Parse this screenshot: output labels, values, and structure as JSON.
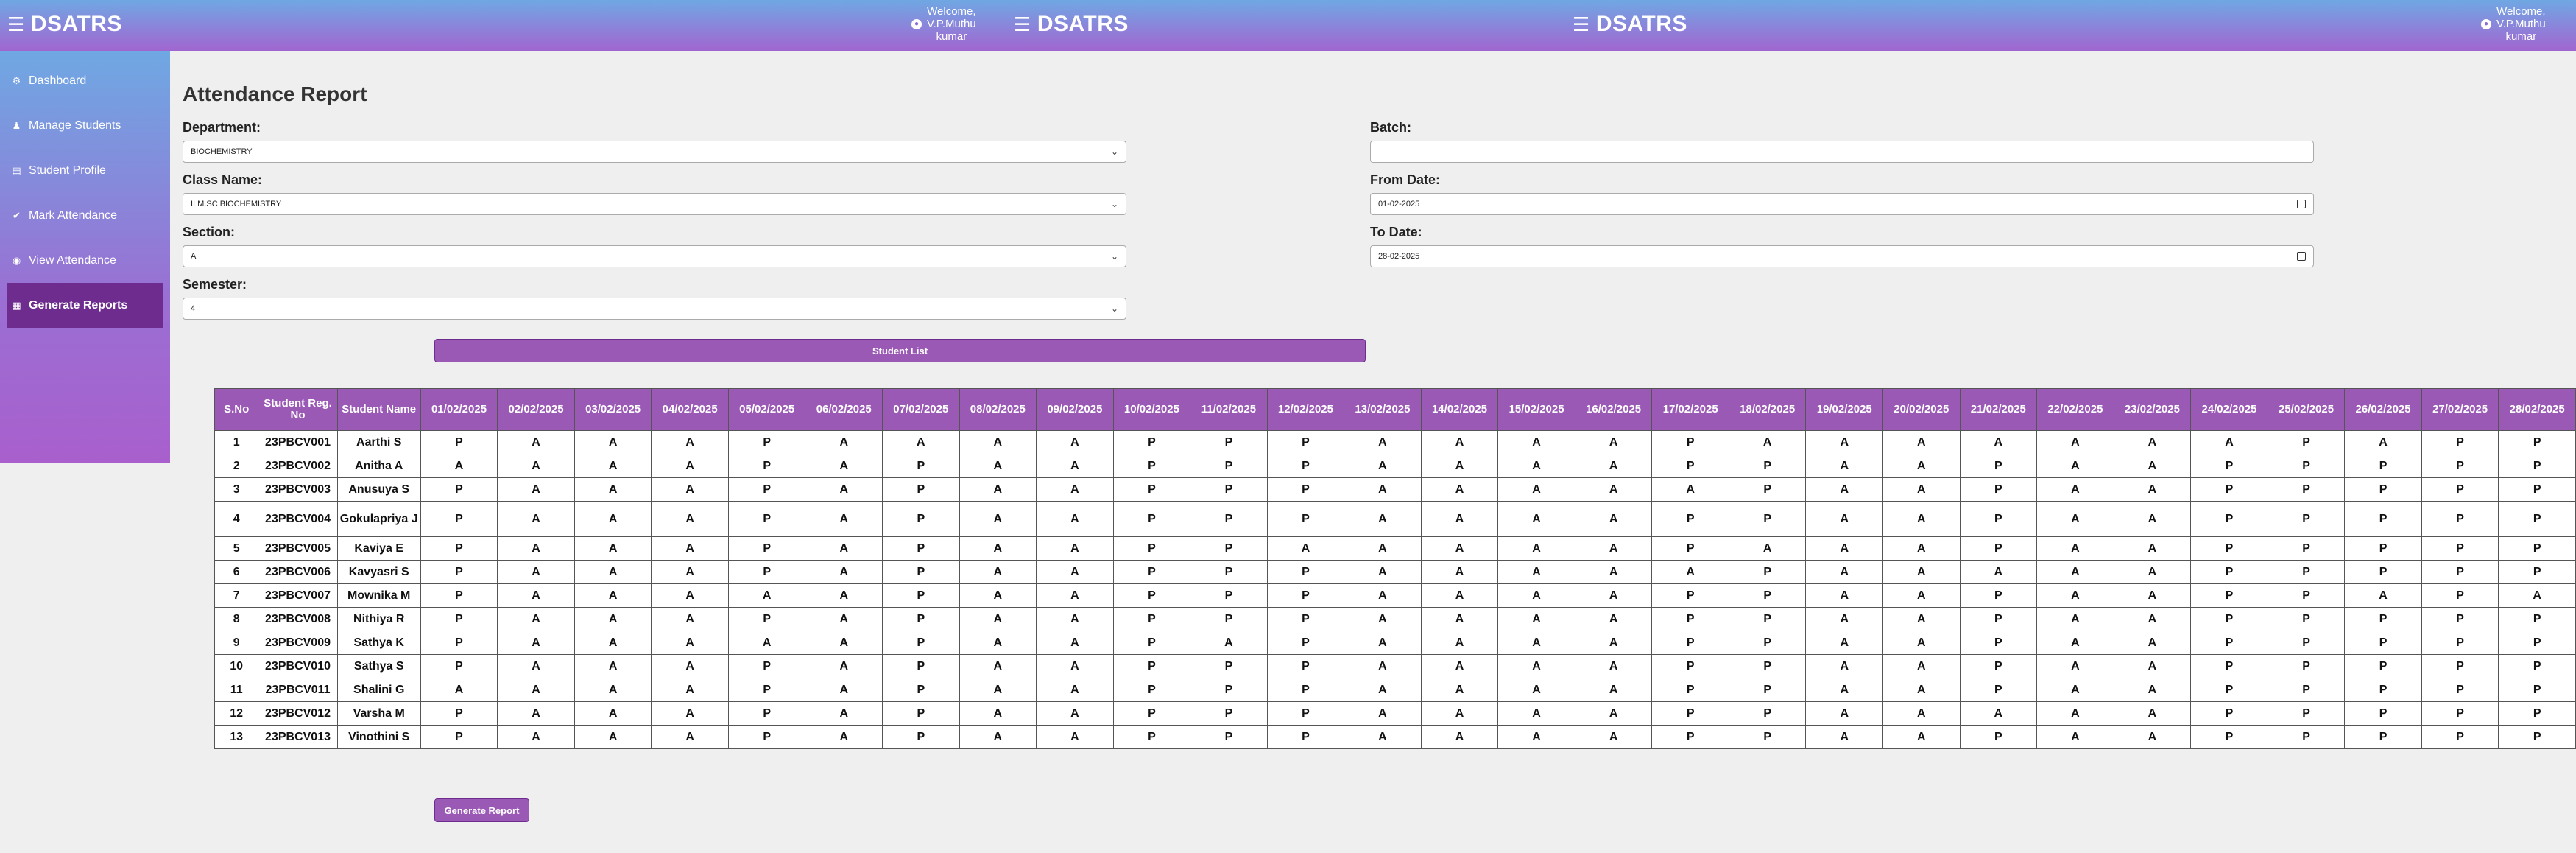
{
  "header": {
    "brand": "DSATRS",
    "welcome_line1": "Welcome,",
    "welcome_line2": "V.P.Muthu",
    "welcome_line3": "kumar",
    "welcome_line2_alt": "V.P.Muthu",
    "welcome_line3_alt": "kumar"
  },
  "sidebar": {
    "items": [
      {
        "label": "Dashboard",
        "icon": "dashboard-icon"
      },
      {
        "label": "Manage Students",
        "icon": "user-icon"
      },
      {
        "label": "Student Profile",
        "icon": "id-card-icon"
      },
      {
        "label": "Mark Attendance",
        "icon": "check-circle-icon"
      },
      {
        "label": "View Attendance",
        "icon": "eye-icon"
      },
      {
        "label": "Generate Reports",
        "icon": "file-icon"
      }
    ]
  },
  "page": {
    "title": "Attendance Report",
    "department_label": "Department:",
    "department_value": "BIOCHEMISTRY",
    "class_label": "Class Name:",
    "class_value": "II M.SC BIOCHEMISTRY",
    "section_label": "Section:",
    "section_value": "A",
    "semester_label": "Semester:",
    "semester_value": "4",
    "batch_label": "Batch:",
    "batch_value": "",
    "from_label": "From Date:",
    "from_value": "01-02-2025",
    "to_label": "To Date:",
    "to_value": "28-02-2025",
    "student_list_button": "Student List",
    "generate_button": "Generate Report"
  },
  "table": {
    "headers": [
      "S.No",
      "Student Reg. No",
      "Student Name",
      "01/02/2025",
      "02/02/2025",
      "03/02/2025",
      "04/02/2025",
      "05/02/2025",
      "06/02/2025",
      "07/02/2025",
      "08/02/2025",
      "09/02/2025",
      "10/02/2025",
      "11/02/2025",
      "12/02/2025",
      "13/02/2025",
      "14/02/2025",
      "15/02/2025",
      "16/02/2025",
      "17/02/2025",
      "18/02/2025",
      "19/02/2025",
      "20/02/2025",
      "21/02/2025",
      "22/02/2025",
      "23/02/2025",
      "24/02/2025",
      "25/02/2025",
      "26/02/2025",
      "27/02/2025",
      "28/02/2025"
    ],
    "rows": [
      [
        "1",
        "23PBCV001",
        "Aarthi S",
        "P",
        "A",
        "A",
        "A",
        "P",
        "A",
        "A",
        "A",
        "A",
        "P",
        "P",
        "P",
        "A",
        "A",
        "A",
        "A",
        "P",
        "A",
        "A",
        "A",
        "A",
        "A",
        "A",
        "A",
        "P",
        "A",
        "P",
        "P"
      ],
      [
        "2",
        "23PBCV002",
        "Anitha A",
        "A",
        "A",
        "A",
        "A",
        "P",
        "A",
        "P",
        "A",
        "A",
        "P",
        "P",
        "P",
        "A",
        "A",
        "A",
        "A",
        "P",
        "P",
        "A",
        "A",
        "P",
        "A",
        "A",
        "P",
        "P",
        "P",
        "P",
        "P"
      ],
      [
        "3",
        "23PBCV003",
        "Anusuya S",
        "P",
        "A",
        "A",
        "A",
        "P",
        "A",
        "P",
        "A",
        "A",
        "P",
        "P",
        "P",
        "A",
        "A",
        "A",
        "A",
        "A",
        "P",
        "A",
        "A",
        "P",
        "A",
        "A",
        "P",
        "P",
        "P",
        "P",
        "P"
      ],
      [
        "4",
        "23PBCV004",
        "Gokulapriya J",
        "P",
        "A",
        "A",
        "A",
        "P",
        "A",
        "P",
        "A",
        "A",
        "P",
        "P",
        "P",
        "A",
        "A",
        "A",
        "A",
        "P",
        "P",
        "A",
        "A",
        "P",
        "A",
        "A",
        "P",
        "P",
        "P",
        "P",
        "P"
      ],
      [
        "5",
        "23PBCV005",
        "Kaviya E",
        "P",
        "A",
        "A",
        "A",
        "P",
        "A",
        "P",
        "A",
        "A",
        "P",
        "P",
        "A",
        "A",
        "A",
        "A",
        "A",
        "P",
        "A",
        "A",
        "A",
        "P",
        "A",
        "A",
        "P",
        "P",
        "P",
        "P",
        "P"
      ],
      [
        "6",
        "23PBCV006",
        "Kavyasri S",
        "P",
        "A",
        "A",
        "A",
        "P",
        "A",
        "P",
        "A",
        "A",
        "P",
        "P",
        "P",
        "A",
        "A",
        "A",
        "A",
        "A",
        "P",
        "A",
        "A",
        "A",
        "A",
        "A",
        "P",
        "P",
        "P",
        "P",
        "P"
      ],
      [
        "7",
        "23PBCV007",
        "Mownika M",
        "P",
        "A",
        "A",
        "A",
        "A",
        "A",
        "P",
        "A",
        "A",
        "P",
        "P",
        "P",
        "A",
        "A",
        "A",
        "A",
        "P",
        "P",
        "A",
        "A",
        "P",
        "A",
        "A",
        "P",
        "P",
        "A",
        "P",
        "A"
      ],
      [
        "8",
        "23PBCV008",
        "Nithiya R",
        "P",
        "A",
        "A",
        "A",
        "P",
        "A",
        "P",
        "A",
        "A",
        "P",
        "P",
        "P",
        "A",
        "A",
        "A",
        "A",
        "P",
        "P",
        "A",
        "A",
        "P",
        "A",
        "A",
        "P",
        "P",
        "P",
        "P",
        "P"
      ],
      [
        "9",
        "23PBCV009",
        "Sathya K",
        "P",
        "A",
        "A",
        "A",
        "A",
        "A",
        "P",
        "A",
        "A",
        "P",
        "A",
        "P",
        "A",
        "A",
        "A",
        "A",
        "P",
        "P",
        "A",
        "A",
        "P",
        "A",
        "A",
        "P",
        "P",
        "P",
        "P",
        "P"
      ],
      [
        "10",
        "23PBCV010",
        "Sathya S",
        "P",
        "A",
        "A",
        "A",
        "P",
        "A",
        "P",
        "A",
        "A",
        "P",
        "P",
        "P",
        "A",
        "A",
        "A",
        "A",
        "P",
        "P",
        "A",
        "A",
        "P",
        "A",
        "A",
        "P",
        "P",
        "P",
        "P",
        "P"
      ],
      [
        "11",
        "23PBCV011",
        "Shalini G",
        "A",
        "A",
        "A",
        "A",
        "P",
        "A",
        "P",
        "A",
        "A",
        "P",
        "P",
        "P",
        "A",
        "A",
        "A",
        "A",
        "P",
        "P",
        "A",
        "A",
        "P",
        "A",
        "A",
        "P",
        "P",
        "P",
        "P",
        "P"
      ],
      [
        "12",
        "23PBCV012",
        "Varsha M",
        "P",
        "A",
        "A",
        "A",
        "P",
        "A",
        "P",
        "A",
        "A",
        "P",
        "P",
        "P",
        "A",
        "A",
        "A",
        "A",
        "P",
        "P",
        "A",
        "A",
        "A",
        "A",
        "A",
        "P",
        "P",
        "P",
        "P",
        "P"
      ],
      [
        "13",
        "23PBCV013",
        "Vinothini S",
        "P",
        "A",
        "A",
        "A",
        "P",
        "A",
        "P",
        "A",
        "A",
        "P",
        "P",
        "P",
        "A",
        "A",
        "A",
        "A",
        "P",
        "P",
        "A",
        "A",
        "P",
        "A",
        "A",
        "P",
        "P",
        "P",
        "P",
        "P"
      ]
    ]
  }
}
